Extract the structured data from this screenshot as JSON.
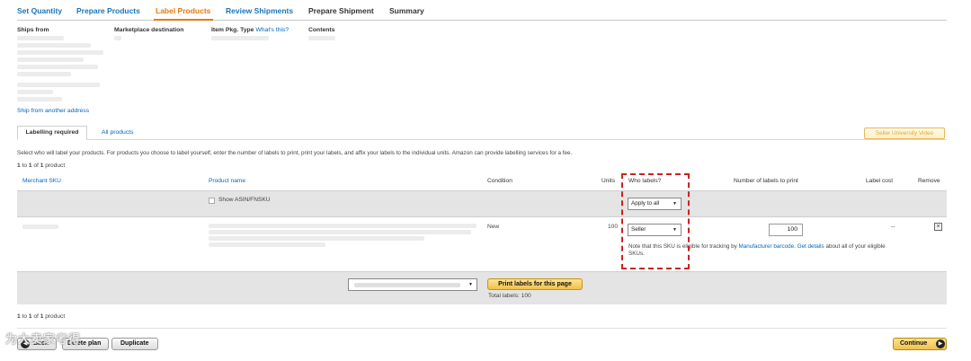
{
  "steps": [
    {
      "label": "Set Quantity",
      "state": "done"
    },
    {
      "label": "Prepare Products",
      "state": "done"
    },
    {
      "label": "Label Products",
      "state": "active"
    },
    {
      "label": "Review Shipments",
      "state": "done"
    },
    {
      "label": "Prepare Shipment",
      "state": "next"
    },
    {
      "label": "Summary",
      "state": "next"
    }
  ],
  "summary": {
    "ships_from": "Ships from",
    "marketplace": "Marketplace destination",
    "item_pkg_type": "Item Pkg. Type",
    "whats_this": "What's this?",
    "contents": "Contents",
    "ship_from_another": "Ship from another address"
  },
  "tabs": {
    "labelling_required": "Labelling required",
    "all_products": "All products",
    "seller_university": "Seller University Video"
  },
  "instructions": "Select who will label your products. For products you choose to label yourself, enter the number of labels to print, print your labels, and affix your labels to the individual units. Amazon can provide labelling services for a fee.",
  "pagination_top": {
    "prefix": "1",
    "mid": " to ",
    "end": "1",
    "of": " of ",
    "total": "1",
    "suffix": " product"
  },
  "pagination_bottom": {
    "prefix": "1",
    "mid": " to ",
    "end": "1",
    "of": " of ",
    "total": "1",
    "suffix": " product"
  },
  "table": {
    "headers": {
      "merchant_sku": "Merchant SKU",
      "product_name": "Product name",
      "condition": "Condition",
      "units": "Units",
      "who_labels": "Who labels?",
      "num_labels": "Number of labels to print",
      "label_cost": "Label cost",
      "remove": "Remove"
    },
    "show_asin": "Show ASIN/FNSKU",
    "apply_to_all": "Apply to all",
    "row": {
      "condition": "New",
      "units": "100",
      "who_labels": "Seller",
      "num_labels": "100",
      "label_cost": "--",
      "note_pre": "Note that this SKU is eligible for tracking by ",
      "manufacturer_barcode": "Manufacturer barcode",
      "get_details": "Get details",
      "note_post": " about all of your eligible SKUs.",
      "note_end": ""
    }
  },
  "print": {
    "button": "Print labels for this page",
    "total_labels": "Total labels: 100"
  },
  "footer": {
    "back": "Back",
    "delete_plan": "Delete plan",
    "duplicate": "Duplicate",
    "continue": "Continue"
  },
  "watermark": "为大卖家考得"
}
